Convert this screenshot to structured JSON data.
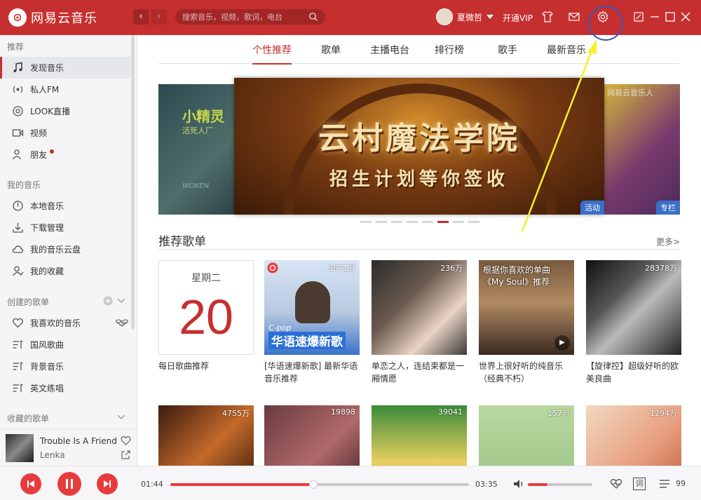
{
  "app": {
    "name": "网易云音乐",
    "logo_glyph": "⊙"
  },
  "topbar": {
    "search_placeholder": "搜索音乐，视频，歌词，电台",
    "username": "夏微哲",
    "vip": "开通VIP",
    "icons": [
      "back-icon",
      "forward-icon",
      "search-icon",
      "skin-icon",
      "mail-icon",
      "settings-icon",
      "miniplayer-icon",
      "minimize-icon",
      "maximize-icon",
      "close-icon"
    ]
  },
  "sidebar": {
    "sections": [
      {
        "title": "推荐",
        "items": [
          {
            "label": "发现音乐",
            "icon": "music-note-icon",
            "active": true
          },
          {
            "label": "私人FM",
            "icon": "radio-icon"
          },
          {
            "label": "LOOK直播",
            "icon": "live-icon"
          },
          {
            "label": "视频",
            "icon": "video-icon"
          },
          {
            "label": "朋友",
            "icon": "friends-icon",
            "dot": true
          }
        ]
      },
      {
        "title": "我的音乐",
        "items": [
          {
            "label": "本地音乐",
            "icon": "local-music-icon"
          },
          {
            "label": "下载管理",
            "icon": "download-icon"
          },
          {
            "label": "我的音乐云盘",
            "icon": "cloud-icon"
          },
          {
            "label": "我的收藏",
            "icon": "collection-icon"
          }
        ]
      },
      {
        "title": "创建的歌单",
        "items": [
          {
            "label": "我喜欢的音乐",
            "icon": "heart-icon"
          },
          {
            "label": "国风歌曲",
            "icon": "playlist-icon"
          },
          {
            "label": "背景音乐",
            "icon": "playlist-icon"
          },
          {
            "label": "英文练唱",
            "icon": "playlist-icon"
          }
        ]
      },
      {
        "title": "收藏的歌单",
        "items": []
      }
    ]
  },
  "now_playing": {
    "title": "Trouble Is A Friend",
    "artist": "Lenka"
  },
  "tabs": [
    {
      "label": "个性推荐",
      "active": true
    },
    {
      "label": "歌单"
    },
    {
      "label": "主播电台"
    },
    {
      "label": "排行榜"
    },
    {
      "label": "歌手"
    },
    {
      "label": "最新音乐"
    }
  ],
  "banner": {
    "left_text": "小精灵",
    "left_sub": "活死人厂",
    "left_brand": "WOKEN",
    "center_title": "云村魔法学院",
    "center_subtitle": "招生计划等你签收",
    "center_tag": "活动",
    "right_brand": "网易云音乐人",
    "right_tag": "专栏",
    "dots_count": 8,
    "active_dot": 6
  },
  "recommend": {
    "title": "推荐歌单",
    "more": "更多>",
    "daily": {
      "weekday": "星期二",
      "day": "20",
      "caption": "每日歌曲推荐"
    },
    "cards": [
      {
        "count": "5671万",
        "title": "[华语速爆新歌] 最新华语音乐推荐",
        "cover_text": "华语速爆新歌",
        "cover_tag": "C-pop"
      },
      {
        "count": "236万",
        "title": "单恋之人，连结束都是一厢情愿"
      },
      {
        "count": "",
        "title": "世界上很好听的纯音乐（经典不朽）",
        "cover_text": "根据你喜欢的单曲《My Soul》推荐"
      },
      {
        "count": "28378万",
        "title": "【旋律控】超级好听的欧美良曲"
      }
    ],
    "row2_counts": [
      "4755万",
      "19898",
      "39041",
      "157万",
      "1294万"
    ]
  },
  "player": {
    "current_time": "01:44",
    "total_time": "03:35",
    "progress": 0.48,
    "volume": 0.3,
    "playlist_count": "99",
    "lyric_label": "词"
  },
  "colors": {
    "brand": "#c62f2f",
    "accent_player": "#e83c3c",
    "annotation_circle": "#3a55b5",
    "annotation_arrow": "#f5f02a"
  }
}
